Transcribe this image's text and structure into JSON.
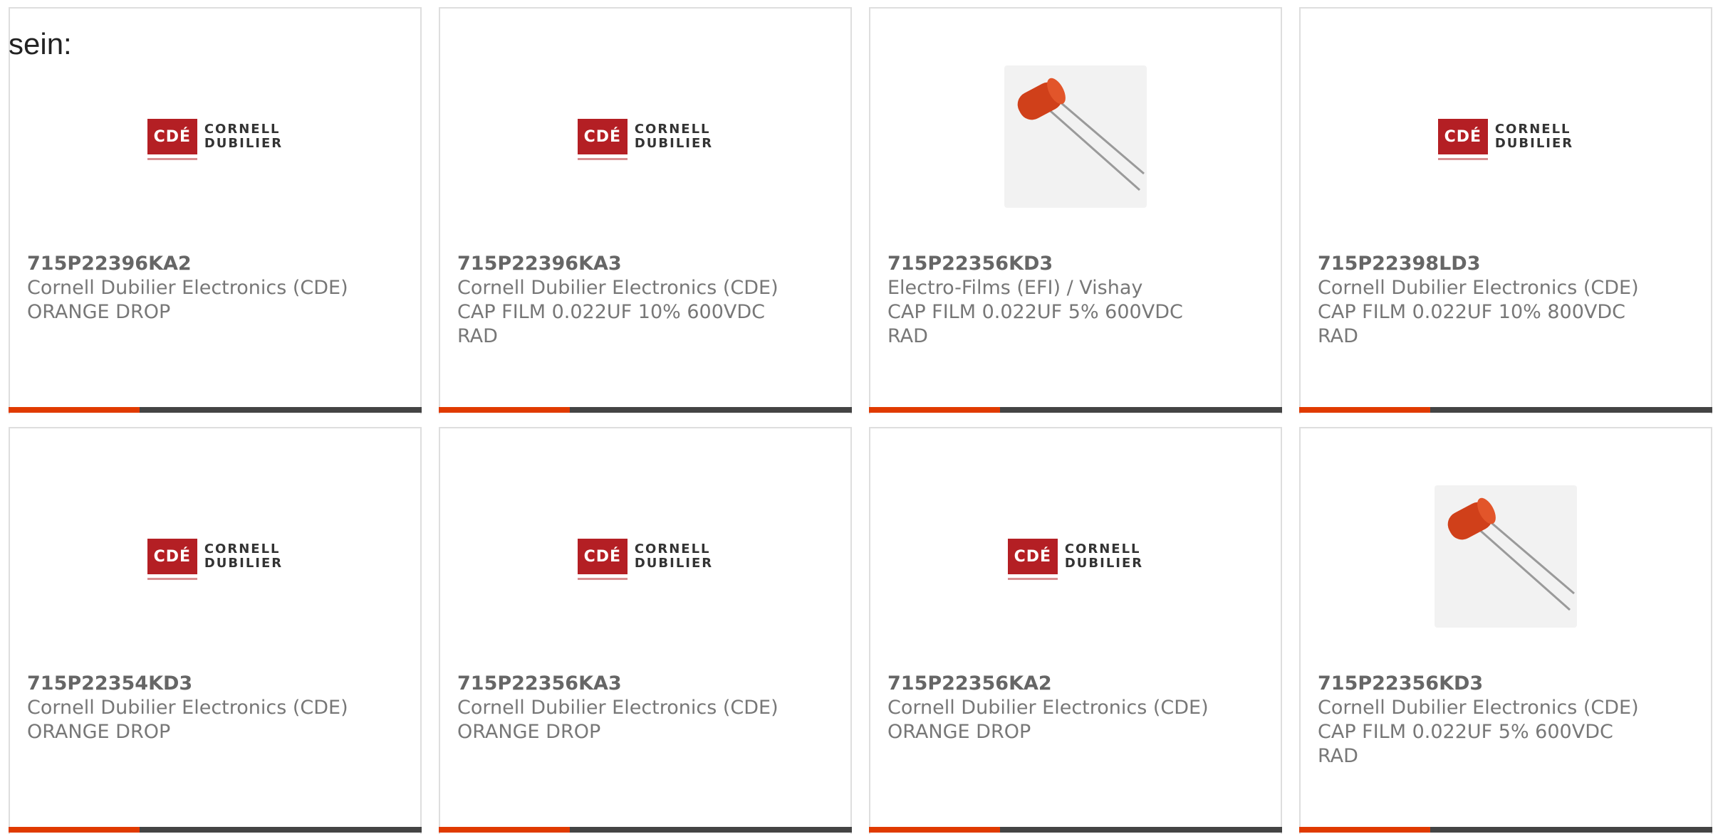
{
  "intro_text": "sein:",
  "logo": {
    "mark": "CDÉ",
    "line1": "CORNELL",
    "line2": "DUBILIER"
  },
  "products": [
    {
      "part": "715P22396KA2",
      "manufacturer": "Cornell Dubilier Electronics (CDE)",
      "description": "ORANGE DROP",
      "image": "cde-logo"
    },
    {
      "part": "715P22396KA3",
      "manufacturer": "Cornell Dubilier Electronics (CDE)",
      "description": "CAP FILM 0.022UF 10% 600VDC RAD",
      "image": "cde-logo"
    },
    {
      "part": "715P22356KD3",
      "manufacturer": "Electro-Films (EFI) / Vishay",
      "description": "CAP FILM 0.022UF 5% 600VDC RAD",
      "image": "capacitor-photo"
    },
    {
      "part": "715P22398LD3",
      "manufacturer": "Cornell Dubilier Electronics (CDE)",
      "description": "CAP FILM 0.022UF 10% 800VDC RAD",
      "image": "cde-logo"
    },
    {
      "part": "715P22354KD3",
      "manufacturer": "Cornell Dubilier Electronics (CDE)",
      "description": "ORANGE DROP",
      "image": "cde-logo"
    },
    {
      "part": "715P22356KA3",
      "manufacturer": "Cornell Dubilier Electronics (CDE)",
      "description": "ORANGE DROP",
      "image": "cde-logo"
    },
    {
      "part": "715P22356KA2",
      "manufacturer": "Cornell Dubilier Electronics (CDE)",
      "description": "ORANGE DROP",
      "image": "cde-logo"
    },
    {
      "part": "715P22356KD3",
      "manufacturer": "Cornell Dubilier Electronics (CDE)",
      "description": "CAP FILM 0.022UF 5% 600VDC RAD",
      "image": "capacitor-photo"
    }
  ],
  "colors": {
    "accent": "#e03a00",
    "bar": "#444444",
    "border": "#dedede"
  }
}
